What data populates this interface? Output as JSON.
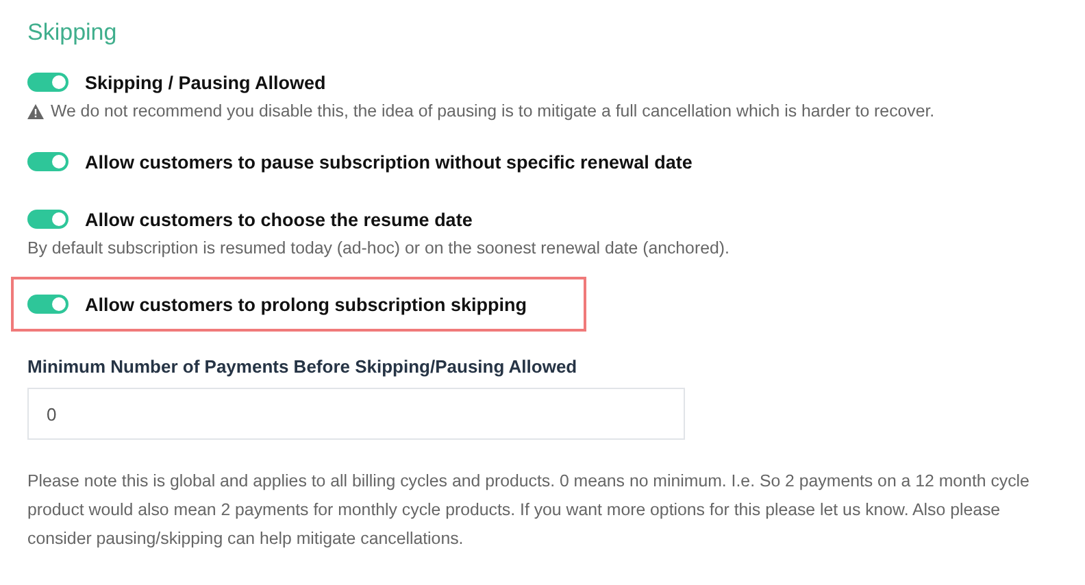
{
  "section": {
    "title": "Skipping"
  },
  "settings": [
    {
      "label": "Skipping / Pausing Allowed",
      "on": true,
      "highlighted": false,
      "note": {
        "kind": "warning",
        "text": "We do not recommend you disable this, the idea of pausing is to mitigate a full cancellation which is harder to recover."
      }
    },
    {
      "label": "Allow customers to pause subscription without specific renewal date",
      "on": true,
      "highlighted": false
    },
    {
      "label": "Allow customers to choose the resume date",
      "on": true,
      "highlighted": false,
      "note": {
        "kind": "plain",
        "text": "By default subscription is resumed today (ad-hoc) or on the soonest renewal date (anchored)."
      }
    },
    {
      "label": "Allow customers to prolong subscription skipping",
      "on": true,
      "highlighted": true
    }
  ],
  "min_payments": {
    "label": "Minimum Number of Payments Before Skipping/Pausing Allowed",
    "value": "0"
  },
  "footnote": "Please note this is global and applies to all billing cycles and products. 0 means no minimum. I.e. So 2 payments on a 12 month cycle product would also mean 2 payments for monthly cycle products. If you want more options for this please let us know. Also please consider pausing/skipping can help mitigate cancellations."
}
